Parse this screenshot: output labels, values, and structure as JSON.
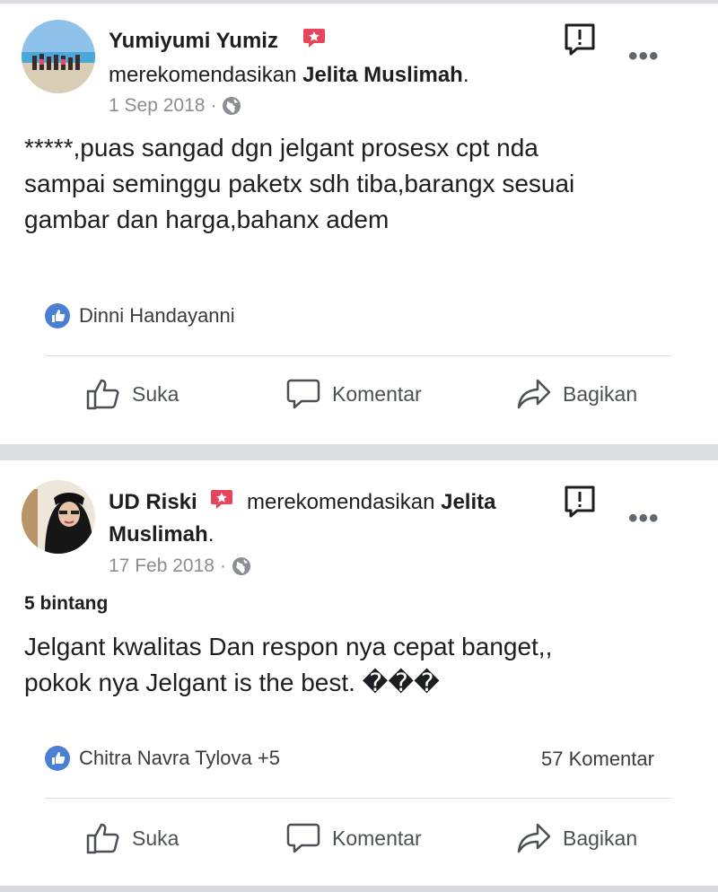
{
  "posts": [
    {
      "author": "Yumiyumi Yumiz",
      "recommends_prefix": "merekomendasikan",
      "page_name": "Jelita Muslimah",
      "period": ".",
      "date": "1 Sep 2018",
      "dot": "·",
      "rating_label": "",
      "body_lines": [
        "*****,puas sangad dgn jelgant prosesx cpt nda",
        "sampai seminggu paketx sdh tiba,barangx sesuai",
        "gambar dan harga,bahanx adem"
      ],
      "reactors": "Dinni Handayanni",
      "comment_count": "",
      "more_icon": "•••"
    },
    {
      "author": "UD Riski",
      "recommends_prefix": "merekomendasikan",
      "page_name_part1": "Jelita",
      "page_name_part2": "Muslimah",
      "period": ".",
      "date": "17 Feb 2018",
      "dot": "·",
      "rating_label": "5 bintang",
      "body_lines": [
        "Jelgant  kwalitas  Dan respon  nya  cepat  banget,,",
        "pokok nya  Jelgant  is the best. ���"
      ],
      "reactors": "Chitra Navra Tylova +5",
      "comment_count": "57 Komentar",
      "more_icon": "•••"
    }
  ],
  "actions": {
    "like": "Suka",
    "comment": "Komentar",
    "share": "Bagikan"
  },
  "colors": {
    "accent_blue": "#4a7fd4",
    "badge_red": "#e7455a",
    "separator": "#dcdee2",
    "muted_text": "#8a8d91"
  },
  "icons": [
    "report-icon",
    "globe-icon",
    "like-reaction-icon",
    "thumbs-up-icon",
    "comment-icon",
    "share-icon",
    "recommendation-badge-icon",
    "more-options-icon"
  ]
}
